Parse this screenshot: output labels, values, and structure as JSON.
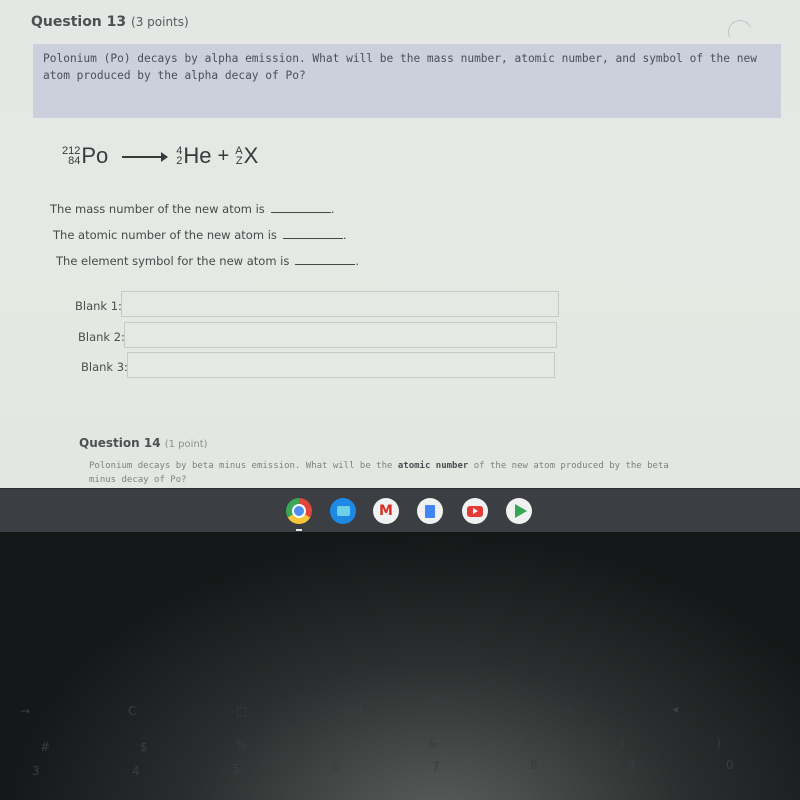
{
  "question13": {
    "title": "Question 13",
    "points": "(3 points)",
    "prompt": "Polonium (Po) decays by alpha emission. What will be the mass number, atomic number, and symbol of the new atom produced by the alpha decay of Po?",
    "equation": {
      "reactant": {
        "mass": "212",
        "atomic": "84",
        "symbol": "Po"
      },
      "product1": {
        "mass": "4",
        "atomic": "2",
        "symbol": "He"
      },
      "plus": "+",
      "product2": {
        "mass": "A",
        "atomic": "Z",
        "symbol": "X"
      }
    },
    "statements": [
      "The mass number of the new atom is",
      "The atomic number of the new atom is",
      "The element symbol for the new atom is"
    ],
    "blanks": [
      {
        "label": "Blank 1:",
        "value": ""
      },
      {
        "label": "Blank 2:",
        "value": ""
      },
      {
        "label": "Blank 3:",
        "value": ""
      }
    ]
  },
  "question14": {
    "title": "Question 14",
    "points": "(1 point)",
    "prompt_part1": "Polonium decays by beta minus emission. What will be the ",
    "prompt_bold": "atomic number",
    "prompt_part2": " of the new atom produced by the beta minus decay of Po?"
  },
  "shelf": {
    "apps": [
      {
        "name": "Chrome",
        "color": "#e0463a"
      },
      {
        "name": "Files",
        "color": "#1e88e5"
      },
      {
        "name": "Gmail",
        "color": "#f1f1f1"
      },
      {
        "name": "Docs",
        "color": "#f1f1f1"
      },
      {
        "name": "YouTube",
        "color": "#f1f1f1"
      },
      {
        "name": "Play Store",
        "color": "#f1f1f1"
      }
    ]
  },
  "keyboard": {
    "keys": [
      "→",
      "C",
      "□",
      "▭II",
      "☼",
      "☼",
      "◂",
      "#",
      "$",
      "%",
      "^",
      "&",
      "*",
      "(",
      ")",
      "3",
      "4",
      "5",
      "6",
      "7",
      "8",
      "9",
      "0"
    ]
  }
}
